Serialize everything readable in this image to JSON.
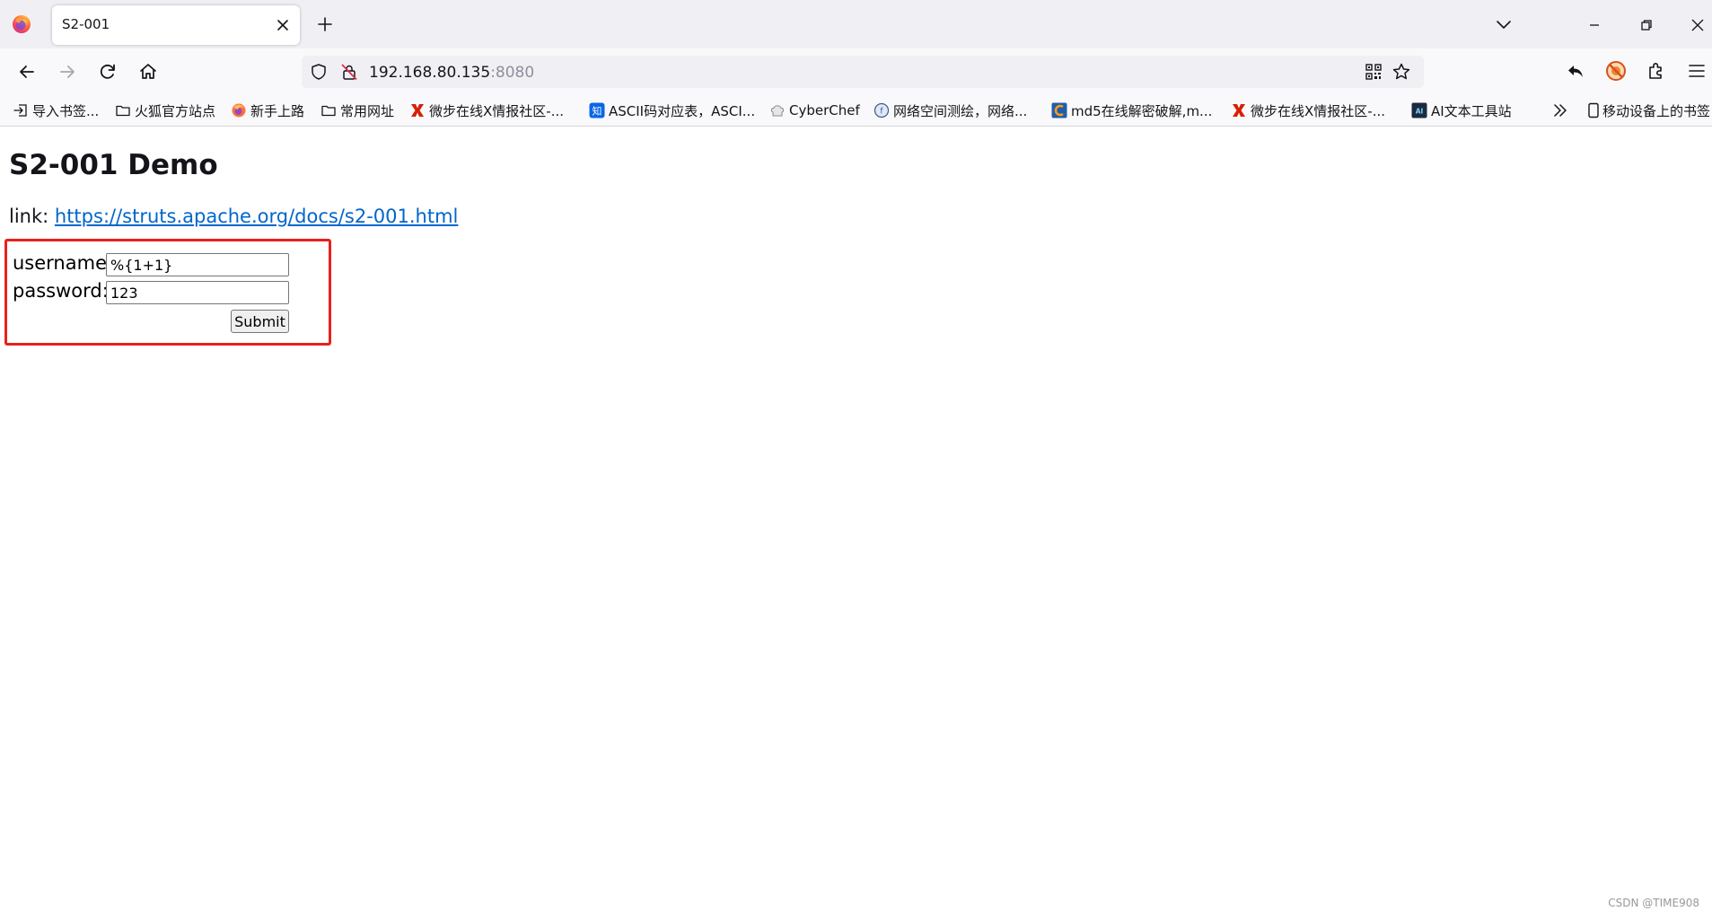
{
  "browser": {
    "tab": {
      "title": "S2-001"
    },
    "address_bar": {
      "host": "192.168.80.135",
      "port": ":8080"
    },
    "icons": {
      "back": "arrow-left-icon",
      "forward": "arrow-right-icon",
      "reload": "reload-icon",
      "home": "home-icon",
      "tracking": "shield-icon",
      "insecure": "insecure-lock-icon",
      "qr": "qr-code-icon",
      "bookmark": "star-icon"
    }
  },
  "bookmarks": [
    {
      "label": "导入书签...",
      "icon": "import-icon"
    },
    {
      "label": "火狐官方站点",
      "icon": "folder-icon"
    },
    {
      "label": "新手上路",
      "icon": "firefox-icon"
    },
    {
      "label": "常用网址",
      "icon": "folder-icon"
    },
    {
      "label": "微步在线X情报社区-...",
      "icon": "x-logo-icon"
    },
    {
      "label": "ASCII码对应表，ASCI...",
      "icon": "zhihu-icon"
    },
    {
      "label": "CyberChef",
      "icon": "chef-hat-icon"
    },
    {
      "label": "网络空间测绘，网络...",
      "icon": "fofa-icon"
    },
    {
      "label": "md5在线解密破解,m...",
      "icon": "cmd5-icon"
    },
    {
      "label": "微步在线X情报社区-...",
      "icon": "x-logo-icon"
    },
    {
      "label": "AI文本工具站",
      "icon": "ai-icon"
    },
    {
      "label": "移动设备上的书签",
      "icon": "mobile-icon"
    }
  ],
  "page": {
    "heading": "S2-001 Demo",
    "link_prefix": "link: ",
    "link_text": "https://struts.apache.org/docs/s2-001.html",
    "form": {
      "username_label": "username:",
      "username_value": "%{1+1}",
      "password_label": "password:",
      "password_value": "123",
      "submit_label": "Submit"
    }
  },
  "watermark": "CSDN @TIME908",
  "colors": {
    "accent_link": "#0066cc",
    "highlight": "#e8211c",
    "chrome_bg": "#f0f0f4",
    "toolbar_bg": "#f9f9fb"
  }
}
